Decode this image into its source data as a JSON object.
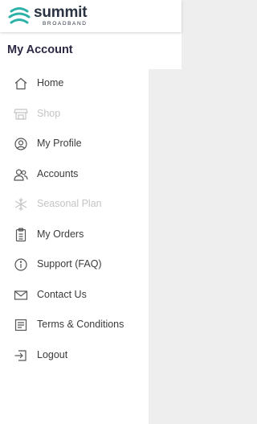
{
  "brand": {
    "name": "summit",
    "tagline": "BROADBAND",
    "accent_color": "#2bb1a8"
  },
  "header": {
    "title": "My Account"
  },
  "colors": {
    "text": "#3b3b3b",
    "disabled": "#c4c4c4",
    "title": "#2d2a45",
    "panel": "#eeeeee"
  },
  "nav": {
    "items": [
      {
        "label": "Home",
        "icon": "home-icon",
        "enabled": true
      },
      {
        "label": "Shop",
        "icon": "store-icon",
        "enabled": false
      },
      {
        "label": "My Profile",
        "icon": "user-circle-icon",
        "enabled": true
      },
      {
        "label": "Accounts",
        "icon": "users-icon",
        "enabled": true
      },
      {
        "label": "Seasonal Plan",
        "icon": "snowflake-icon",
        "enabled": false
      },
      {
        "label": "My Orders",
        "icon": "clipboard-icon",
        "enabled": true
      },
      {
        "label": "Support (FAQ)",
        "icon": "info-icon",
        "enabled": true
      },
      {
        "label": "Contact Us",
        "icon": "envelope-icon",
        "enabled": true
      },
      {
        "label": "Terms & Conditions",
        "icon": "document-icon",
        "enabled": true
      },
      {
        "label": "Logout",
        "icon": "logout-icon",
        "enabled": true
      }
    ]
  }
}
